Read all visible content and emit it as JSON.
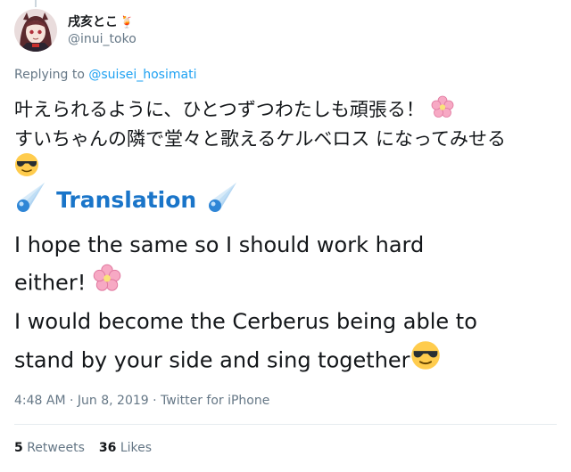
{
  "user": {
    "display_name": "戌亥とこ",
    "handle": "@inui_toko",
    "name_emoji": "🍹"
  },
  "reply": {
    "prefix": "Replying to",
    "mention": "@suisei_hosimati"
  },
  "tweet": {
    "jp_line1": "叶えられるように、ひとつずつわたしも頑張る！",
    "jp_line2": "すいちゃんの隣で堂々と歌えるケルベロス になってみせる",
    "translation_label": "Translation",
    "en_line1": "I hope the same so I should work hard",
    "en_line2": "either!",
    "en_line3": "I would become the Cerberus being able to",
    "en_line4": "stand by your side and sing together"
  },
  "meta": {
    "time": "4:48 AM",
    "sep": "·",
    "date": "Jun 8, 2019",
    "source": "Twitter for iPhone"
  },
  "stats": {
    "retweets_count": "5",
    "retweets_label": "Retweets",
    "likes_count": "36",
    "likes_label": "Likes"
  },
  "icons": {
    "flower": "cherry-blossom-icon",
    "sunglasses": "sunglasses-face-icon",
    "comet": "comet-icon"
  },
  "colors": {
    "link": "#1da1f2",
    "translation": "#1a75c9",
    "secondary_text": "#657786"
  }
}
